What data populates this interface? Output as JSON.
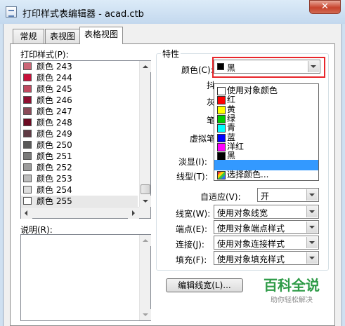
{
  "window": {
    "title": "打印样式表编辑器 - acad.ctb",
    "close_glyph": "✕"
  },
  "tabs": [
    {
      "label": "常规",
      "active": false
    },
    {
      "label": "表视图",
      "active": false
    },
    {
      "label": "表格视图",
      "active": true
    }
  ],
  "print_styles": {
    "label": "打印样式(P):",
    "items": [
      {
        "label": "颜色 243",
        "color": "#cc6677"
      },
      {
        "label": "颜色 244",
        "color": "#c8103a"
      },
      {
        "label": "颜色 245",
        "color": "#c04a60"
      },
      {
        "label": "颜色 246",
        "color": "#900e30"
      },
      {
        "label": "颜色 247",
        "color": "#8c4a58"
      },
      {
        "label": "颜色 248",
        "color": "#6c0a22"
      },
      {
        "label": "颜色 249",
        "color": "#5f3a44"
      },
      {
        "label": "颜色 250",
        "color": "#595959"
      },
      {
        "label": "颜色 251",
        "color": "#7a7a7a"
      },
      {
        "label": "颜色 252",
        "color": "#9c9c9c"
      },
      {
        "label": "颜色 253",
        "color": "#bdbdbd"
      },
      {
        "label": "颜色 254",
        "color": "#dedede"
      },
      {
        "label": "颜色 255",
        "color": "#ffffff"
      }
    ],
    "selected_index": 12
  },
  "description": {
    "label": "说明(R):"
  },
  "properties": {
    "group_title": "特性",
    "color_label": "颜色(C):",
    "color_value": "黑",
    "color_value_swatch": "#000000",
    "partial_labels": [
      "抖",
      "灰",
      "笔",
      "虚拟笔"
    ],
    "screening_label": "淡显(I):",
    "linetype_label": "线型(T):",
    "adaptive_label": "自适应(V):",
    "adaptive_value": "开",
    "lineweight_label": "线宽(W):",
    "lineweight_value": "使用对象线宽",
    "endpoint_label": "端点(E):",
    "endpoint_value": "使用对象端点样式",
    "join_label": "连接(J):",
    "join_value": "使用对象连接样式",
    "fill_label": "填充(F):",
    "fill_value": "使用对象填充样式"
  },
  "color_dropdown": {
    "selected_index": 8,
    "items": [
      {
        "label": "使用对象颜色",
        "color": "#ffffff"
      },
      {
        "label": "红",
        "color": "#ff0000"
      },
      {
        "label": "黄",
        "color": "#ffff00"
      },
      {
        "label": "绿",
        "color": "#00cc00"
      },
      {
        "label": "青",
        "color": "#00ffff"
      },
      {
        "label": "蓝",
        "color": "#0000ff"
      },
      {
        "label": "洋红",
        "color": "#ff00ff"
      },
      {
        "label": "黑",
        "color": "#000000"
      },
      {
        "label": "",
        "color": ""
      },
      {
        "label": "选择颜色...",
        "color": "multicolor"
      }
    ]
  },
  "buttons": {
    "edit_lineweights": "编辑线宽(L)..."
  },
  "watermark": {
    "main": "百科全说",
    "sub": "助你轻松解决"
  }
}
